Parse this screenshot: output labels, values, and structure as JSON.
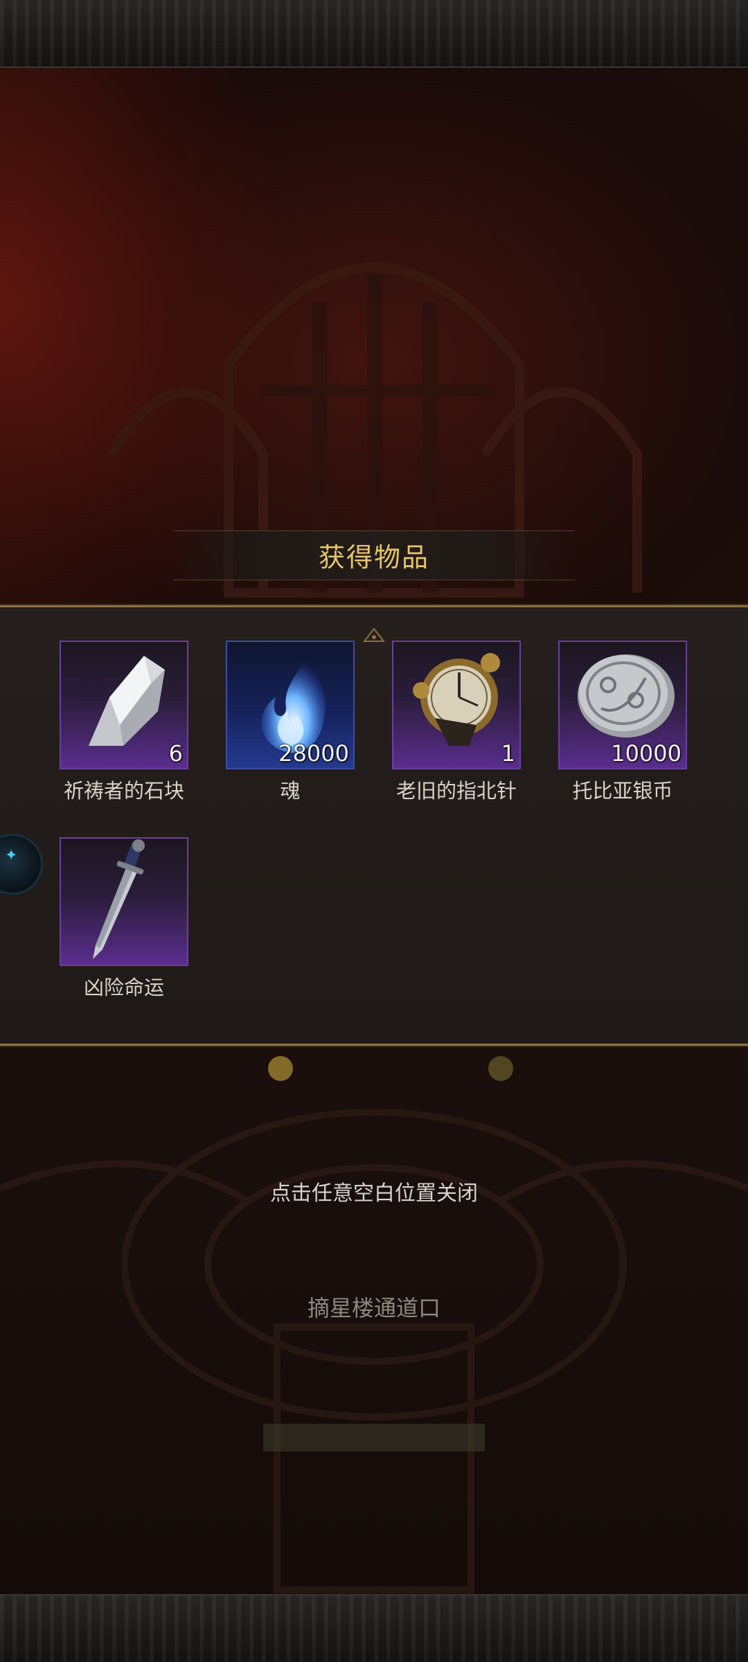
{
  "dialog": {
    "title": "获得物品"
  },
  "items": [
    {
      "name": "祈祷者的石块",
      "count": "6",
      "icon": "stone-icon",
      "rarity_color": "#6b3f9e"
    },
    {
      "name": "魂",
      "count": "28000",
      "icon": "soul-flame-icon",
      "rarity_color": "#3d4fa0"
    },
    {
      "name": "老旧的指北针",
      "count": "1",
      "icon": "compass-icon",
      "rarity_color": "#6b3f9e"
    },
    {
      "name": "托比亚银币",
      "count": "10000",
      "icon": "silver-coin-icon",
      "rarity_color": "#6b3f9e"
    },
    {
      "name": "凶险命运",
      "count": "",
      "icon": "dagger-icon",
      "rarity_color": "#6b3f9e"
    }
  ],
  "hint": {
    "close_text": "点击任意空白位置关闭"
  },
  "location": {
    "label": "摘星楼通道口"
  },
  "side_badge": {
    "icon": "floating-assistant-icon"
  },
  "colors": {
    "title_gold": "#e8c56a",
    "panel_border_gold": "#8a7240",
    "epic_purple": "#6b3f9e"
  }
}
